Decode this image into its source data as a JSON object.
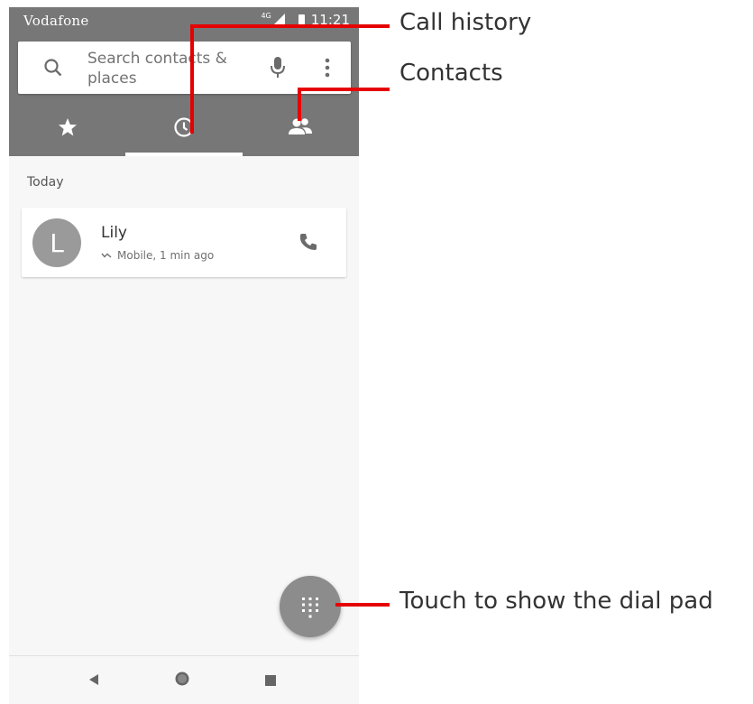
{
  "status_bar": {
    "carrier": "Vodafone",
    "network": "4G",
    "time": "11:21"
  },
  "search": {
    "placeholder": "Search contacts & places",
    "icon": "search-icon",
    "voice_icon": "microphone-icon",
    "menu_icon": "more-vert-icon"
  },
  "tabs": [
    {
      "icon": "star-icon",
      "selected": false
    },
    {
      "icon": "clock-icon",
      "selected": true
    },
    {
      "icon": "contacts-icon",
      "selected": false
    }
  ],
  "call_log": {
    "section": "Today",
    "entries": [
      {
        "avatar_letter": "L",
        "name": "Lily",
        "detail": "Mobile, 1 min ago"
      }
    ]
  },
  "fab": {
    "icon": "dialpad-icon"
  },
  "nav": {
    "back_icon": "back-icon",
    "home_icon": "home-icon",
    "recents_icon": "recents-icon"
  },
  "callouts": {
    "call_history": "Call history",
    "contacts": "Contacts",
    "dialpad": "Touch to show the dial pad"
  },
  "colors": {
    "app_bar": "#777777",
    "callout_line": "#e60000",
    "fab": "#8c8c8c",
    "avatar": "#9a9a9a"
  }
}
